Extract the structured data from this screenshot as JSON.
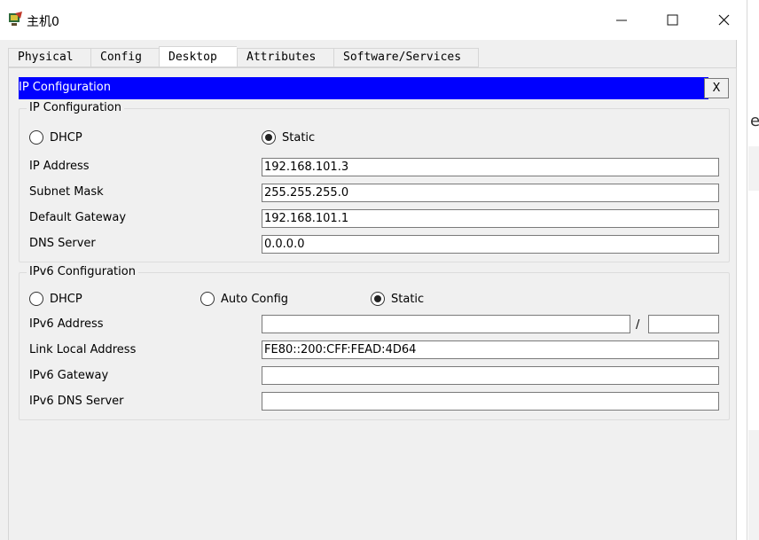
{
  "window": {
    "title": "主机0",
    "minimize": "—",
    "maximize": "☐",
    "close": "✕"
  },
  "outside": {
    "glyph": "ell"
  },
  "tabs": [
    "Physical",
    "Config",
    "Desktop",
    "Attributes",
    "Software/Services"
  ],
  "active_tab": "Desktop",
  "ip_panel": {
    "title": "IP Configuration",
    "close_label": "X"
  },
  "ipv4": {
    "legend": "IP Configuration",
    "dhcp_label": "DHCP",
    "static_label": "Static",
    "mode": "Static",
    "ip_address_label": "IP Address",
    "ip_address_value": "192.168.101.3",
    "subnet_mask_label": "Subnet Mask",
    "subnet_mask_value": "255.255.255.0",
    "default_gateway_label": "Default Gateway",
    "default_gateway_value": "192.168.101.1",
    "dns_server_label": "DNS Server",
    "dns_server_value": "0.0.0.0"
  },
  "ipv6": {
    "legend": "IPv6 Configuration",
    "dhcp_label": "DHCP",
    "auto_config_label": "Auto Config",
    "static_label": "Static",
    "mode": "Static",
    "address_label": "IPv6 Address",
    "address_value": "",
    "prefix_value": "",
    "slash": "/",
    "link_local_label": "Link Local Address",
    "link_local_value": "FE80::200:CFF:FEAD:4D64",
    "gateway_label": "IPv6 Gateway",
    "gateway_value": "",
    "dns_label": "IPv6 DNS Server",
    "dns_value": ""
  }
}
